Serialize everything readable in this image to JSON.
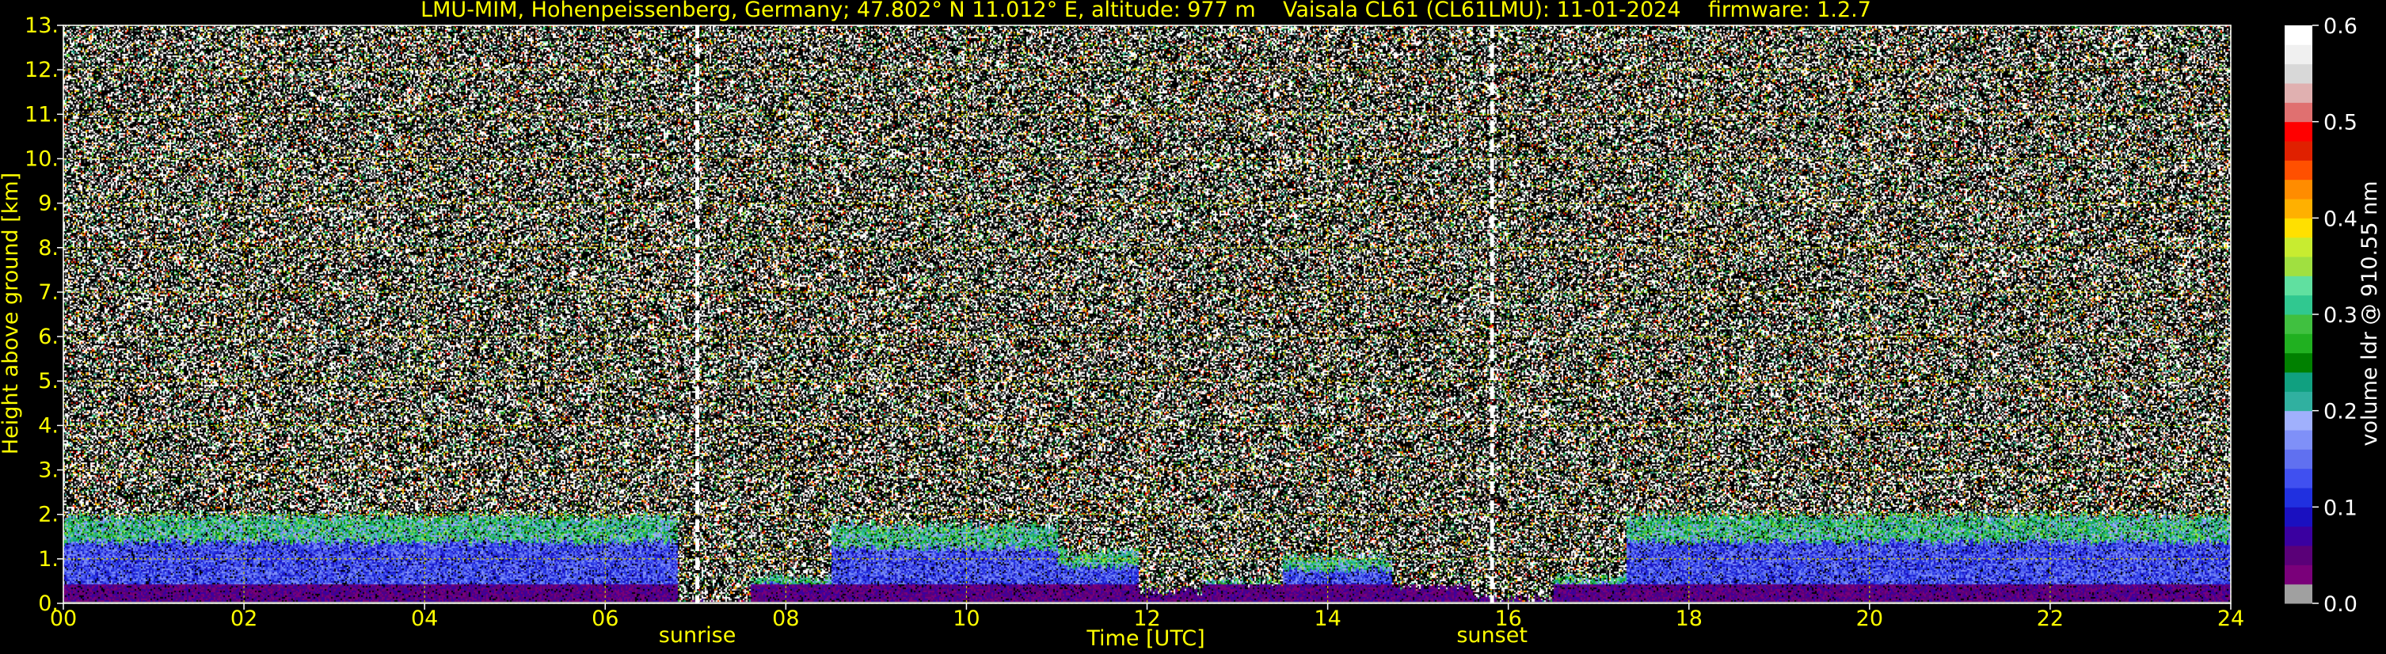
{
  "chart_data": {
    "type": "heatmap",
    "title": "LMU-MIM, Hohenpeissenberg, Germany; 47.802° N 11.012° E, altitude: 977 m    Vaisala CL61 (CL61LMU): 11-01-2024    firmware: 1.2.7",
    "xlabel": "Time [UTC]",
    "ylabel": "Height above ground [km]",
    "xlim": [
      0,
      24
    ],
    "ylim": [
      0,
      13
    ],
    "x_ticks": [
      {
        "value": 0,
        "label": "00"
      },
      {
        "value": 2,
        "label": "02"
      },
      {
        "value": 4,
        "label": "04"
      },
      {
        "value": 6,
        "label": "06"
      },
      {
        "value": 8,
        "label": "08"
      },
      {
        "value": 10,
        "label": "10"
      },
      {
        "value": 12,
        "label": "12"
      },
      {
        "value": 14,
        "label": "14"
      },
      {
        "value": 16,
        "label": "16"
      },
      {
        "value": 18,
        "label": "18"
      },
      {
        "value": 20,
        "label": "20"
      },
      {
        "value": 22,
        "label": "22"
      },
      {
        "value": 24,
        "label": "24"
      }
    ],
    "y_ticks": [
      {
        "value": 0,
        "label": "0."
      },
      {
        "value": 1,
        "label": "1."
      },
      {
        "value": 2,
        "label": "2."
      },
      {
        "value": 3,
        "label": "3."
      },
      {
        "value": 4,
        "label": "4."
      },
      {
        "value": 5,
        "label": "5."
      },
      {
        "value": 6,
        "label": "6."
      },
      {
        "value": 7,
        "label": "7."
      },
      {
        "value": 8,
        "label": "8."
      },
      {
        "value": 9,
        "label": "9."
      },
      {
        "value": 10,
        "label": "10."
      },
      {
        "value": 11,
        "label": "11."
      },
      {
        "value": 12,
        "label": "12."
      },
      {
        "value": 13,
        "label": "13."
      }
    ],
    "grid": true,
    "annotations": [
      {
        "text": "sunrise",
        "x": 7.02
      },
      {
        "text": "sunset",
        "x": 15.82
      }
    ],
    "colorbar": {
      "label": "volume ldr @ 910.55 nm",
      "range": [
        0.0,
        0.6
      ],
      "ticks": [
        {
          "value": 0.0,
          "label": "0.0"
        },
        {
          "value": 0.1,
          "label": "0.1"
        },
        {
          "value": 0.2,
          "label": "0.2"
        },
        {
          "value": 0.3,
          "label": "0.3"
        },
        {
          "value": 0.4,
          "label": "0.4"
        },
        {
          "value": 0.5,
          "label": "0.5"
        },
        {
          "value": 0.6,
          "label": "0.6"
        }
      ],
      "colors": [
        "#a0a0a0",
        "#7a007a",
        "#5a0078",
        "#3a00a0",
        "#1a10c0",
        "#2030e0",
        "#4050f0",
        "#6070f0",
        "#7f90f8",
        "#a0b0fc",
        "#30b0a0",
        "#10a080",
        "#008000",
        "#20b020",
        "#40c040",
        "#30c890",
        "#60e0a0",
        "#a0e040",
        "#c8ec30",
        "#ffe000",
        "#ffb000",
        "#ff8c00",
        "#ff5000",
        "#e02000",
        "#ff0000",
        "#e07070",
        "#e0b0b0",
        "#d8d8d8",
        "#f0f0f0",
        "#ffffff"
      ]
    },
    "regimes": [
      {
        "x": [
          0.0,
          6.8
        ],
        "top": 2.0
      },
      {
        "x": [
          6.8,
          7.6
        ],
        "top": 0.0
      },
      {
        "x": [
          7.6,
          8.5
        ],
        "top": 0.6
      },
      {
        "x": [
          8.5,
          11.0
        ],
        "top": 1.8
      },
      {
        "x": [
          11.0,
          11.9
        ],
        "top": 1.2
      },
      {
        "x": [
          11.9,
          12.6
        ],
        "top": 0.3
      },
      {
        "x": [
          12.6,
          13.5
        ],
        "top": 0.5
      },
      {
        "x": [
          13.5,
          14.7
        ],
        "top": 1.1
      },
      {
        "x": [
          14.7,
          15.6
        ],
        "top": 0.4
      },
      {
        "x": [
          15.6,
          16.5
        ],
        "top": 0.1
      },
      {
        "x": [
          16.5,
          17.3
        ],
        "top": 0.6
      },
      {
        "x": [
          17.3,
          24.0
        ],
        "top": 2.0
      }
    ]
  },
  "colors": {
    "text": "#ffff00",
    "grid": "#c8c800",
    "background": "#000000",
    "noise_light": "#ffffff",
    "noise_dark": "#555555"
  }
}
